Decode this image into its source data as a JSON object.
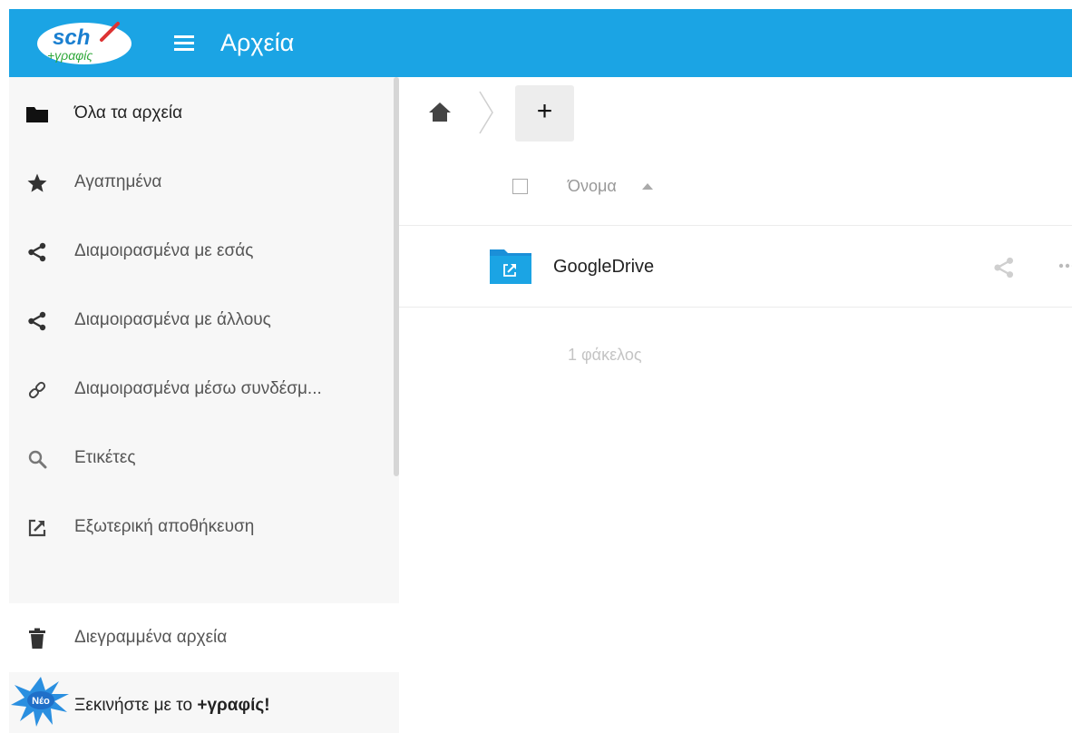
{
  "header": {
    "app_title": "Αρχεία",
    "logo_text": "sch +γραφίς",
    "bg_color": "#1ba4e4"
  },
  "sidebar": {
    "items": [
      {
        "label": "Όλα τα αρχεία",
        "icon": "folder-icon",
        "active": true
      },
      {
        "label": "Αγαπημένα",
        "icon": "star-icon"
      },
      {
        "label": "Διαμοιρασμένα με εσάς",
        "icon": "share-icon"
      },
      {
        "label": "Διαμοιρασμένα με άλλους",
        "icon": "share-icon"
      },
      {
        "label": "Διαμοιρασμένα μέσω συνδέσμ...",
        "icon": "link-icon"
      },
      {
        "label": "Ετικέτες",
        "icon": "search-icon"
      },
      {
        "label": "Εξωτερική αποθήκευση",
        "icon": "external-link-icon"
      }
    ],
    "trash_label": "Διεγραμμένα αρχεία",
    "promo": {
      "badge": "Νέο",
      "text_prefix": "Ξεκινήστε με το ",
      "text_bold": "+γραφίς!"
    }
  },
  "main": {
    "new_button_label": "+",
    "column_name": "Όνομα",
    "files": [
      {
        "name": "GoogleDrive",
        "type": "external-folder"
      }
    ],
    "summary": "1 φάκελος"
  }
}
